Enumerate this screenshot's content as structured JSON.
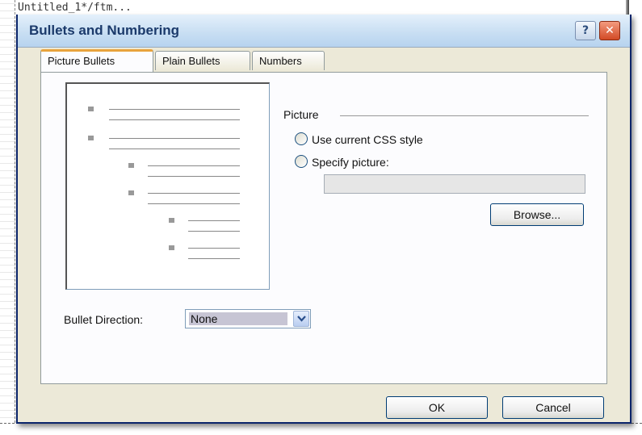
{
  "background": {
    "code_fragment_top": "Untitled_1*/ftm..."
  },
  "dialog": {
    "title": "Bullets and Numbering",
    "help_label": "?",
    "close_label": "✕"
  },
  "tabs": [
    {
      "label": "Picture Bullets",
      "active": true
    },
    {
      "label": "Plain Bullets",
      "active": false
    },
    {
      "label": "Numbers",
      "active": false
    }
  ],
  "picture": {
    "section_label": "Picture",
    "options": [
      {
        "label": "Use current CSS style",
        "selected": false
      },
      {
        "label": "Specify picture:",
        "selected": false
      }
    ],
    "path_value": "",
    "browse_label": "Browse..."
  },
  "bullet_direction": {
    "label": "Bullet Direction:",
    "value": "None"
  },
  "buttons": {
    "ok": "OK",
    "cancel": "Cancel"
  },
  "colors": {
    "dialog_bg": "#ece9d8",
    "tab_accent": "#e8a33d",
    "close_button": "#d24a26"
  }
}
